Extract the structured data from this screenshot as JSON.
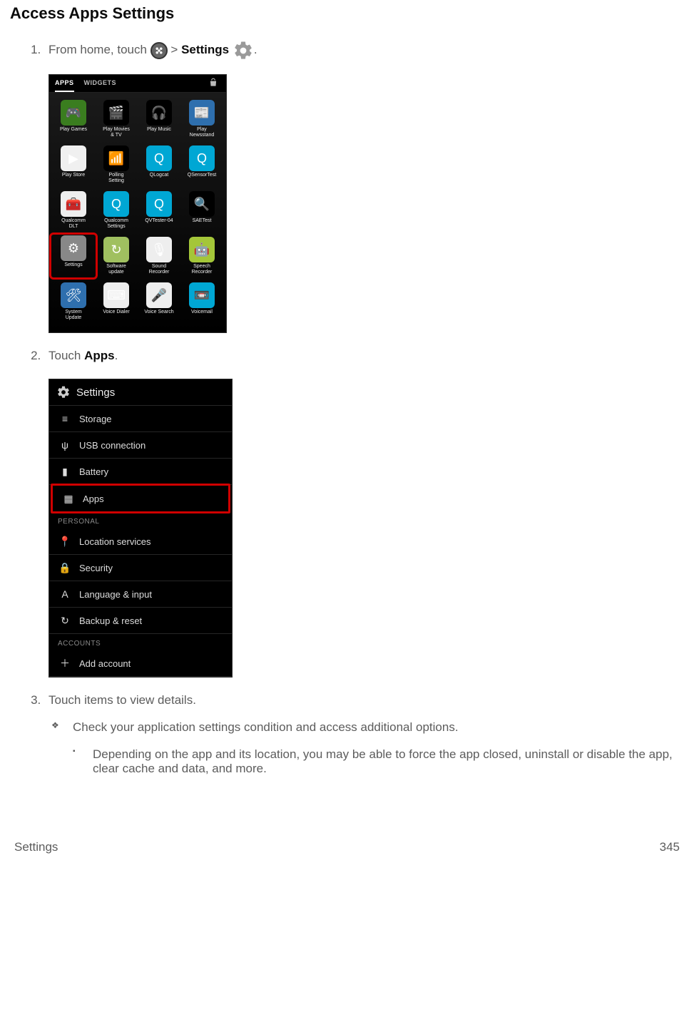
{
  "title": "Access Apps Settings",
  "steps": {
    "1": {
      "prefix": "From home, touch ",
      "mid": " > ",
      "settings_label": "Settings",
      "suffix": "."
    },
    "2": {
      "prefix": "Touch ",
      "apps_label": "Apps",
      "suffix": "."
    },
    "3": {
      "text": "Touch items to view details."
    }
  },
  "sub_bullets": {
    "diamond": "Check your application settings condition and access additional options.",
    "square": "Depending on the app and its location, you may be able to force the app closed, uninstall or disable the app, clear cache and data, and more."
  },
  "shot1": {
    "tabs": {
      "apps": "APPS",
      "widgets": "WIDGETS"
    },
    "apps": [
      {
        "label": "Play Games",
        "bg": "#3a7d1f",
        "glyph": "🎮"
      },
      {
        "label": "Play Movies\n& TV",
        "bg": "#000",
        "glyph": "🎬"
      },
      {
        "label": "Play Music",
        "bg": "#000",
        "glyph": "🎧"
      },
      {
        "label": "Play\nNewsstand",
        "bg": "#2e6fae",
        "glyph": "📰"
      },
      {
        "label": "Play Store",
        "bg": "#f0f0f0",
        "glyph": "▶"
      },
      {
        "label": "Polling\nSetting",
        "bg": "#000",
        "glyph": "📶"
      },
      {
        "label": "QLogcat",
        "bg": "#00a7d4",
        "glyph": "Q"
      },
      {
        "label": "QSensorTest",
        "bg": "#00a7d4",
        "glyph": "Q"
      },
      {
        "label": "Qualcomm\nDLT",
        "bg": "#eee",
        "glyph": "🧰"
      },
      {
        "label": "Qualcomm\nSettings",
        "bg": "#00a7d4",
        "glyph": "Q"
      },
      {
        "label": "QVTester-04",
        "bg": "#00a7d4",
        "glyph": "Q"
      },
      {
        "label": "SAETest",
        "bg": "#000",
        "glyph": "🔍"
      },
      {
        "label": "Settings",
        "bg": "#888",
        "glyph": "⚙",
        "highlight": true
      },
      {
        "label": "Software\nupdate",
        "bg": "#a0c060",
        "glyph": "↻"
      },
      {
        "label": "Sound\nRecorder",
        "bg": "#eee",
        "glyph": "🎙"
      },
      {
        "label": "Speech\nRecorder",
        "bg": "#a4c639",
        "glyph": "🤖"
      },
      {
        "label": "System\nUpdate",
        "bg": "#2e6fae",
        "glyph": "🛠"
      },
      {
        "label": "Voice Dialer",
        "bg": "#eee",
        "glyph": "⌨"
      },
      {
        "label": "Voice Search",
        "bg": "#eee",
        "glyph": "🎤"
      },
      {
        "label": "Voicemail",
        "bg": "#00a7d4",
        "glyph": "📼"
      }
    ]
  },
  "shot2": {
    "header": "Settings",
    "rows": [
      {
        "icon": "≡",
        "label": "Storage"
      },
      {
        "icon": "ψ",
        "label": "USB connection"
      },
      {
        "icon": "▮",
        "label": "Battery"
      },
      {
        "icon": "▦",
        "label": "Apps",
        "highlight": true
      }
    ],
    "cat1": "PERSONAL",
    "rows2": [
      {
        "icon": "📍",
        "label": "Location services"
      },
      {
        "icon": "🔒",
        "label": "Security"
      },
      {
        "icon": "A",
        "label": "Language & input"
      },
      {
        "icon": "↻",
        "label": "Backup & reset"
      }
    ],
    "cat2": "ACCOUNTS",
    "rows3": [
      {
        "icon": "＋",
        "label": "Add account"
      }
    ]
  },
  "footer": {
    "left": "Settings",
    "right": "345"
  }
}
